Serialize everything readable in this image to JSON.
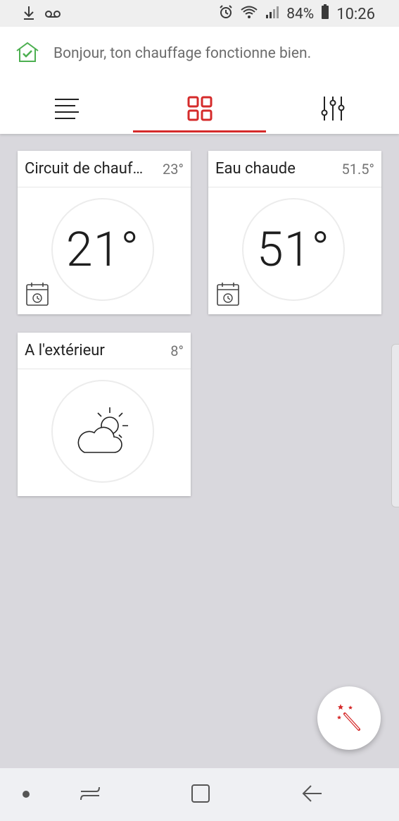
{
  "status_bar": {
    "left_icons": [
      "download-icon",
      "voicemail-icon"
    ],
    "right_icons": [
      "alarm-icon",
      "wifi-icon",
      "signal-icon",
      "battery-icon"
    ],
    "battery": "84%",
    "time": "10:26"
  },
  "header": {
    "banner_icon": "home-check-icon",
    "banner_text": "Bonjour, ton chauffage fonctionne bien.",
    "tabs": [
      {
        "icon": "menu-icon",
        "active": false
      },
      {
        "icon": "grid-icon",
        "active": true
      },
      {
        "icon": "sliders-icon",
        "active": false
      }
    ]
  },
  "cards": [
    {
      "title": "Circuit de chauf…",
      "value": "23°",
      "dial": "21°",
      "icon": "calendar-clock-icon"
    },
    {
      "title": "Eau chaude",
      "value": "51.5°",
      "dial": "51°",
      "icon": "calendar-clock-icon"
    },
    {
      "title": "A l'extérieur",
      "value": "8°",
      "icon": "partly-cloudy-icon"
    }
  ],
  "fab": {
    "icon": "magic-wand-icon"
  },
  "nav_bar": {
    "icons": [
      "dot-icon",
      "recents-icon",
      "home-icon",
      "back-icon"
    ]
  },
  "colors": {
    "accent": "#d52b2b",
    "ok_green": "#4caf50",
    "background": "#d9d8dd"
  }
}
